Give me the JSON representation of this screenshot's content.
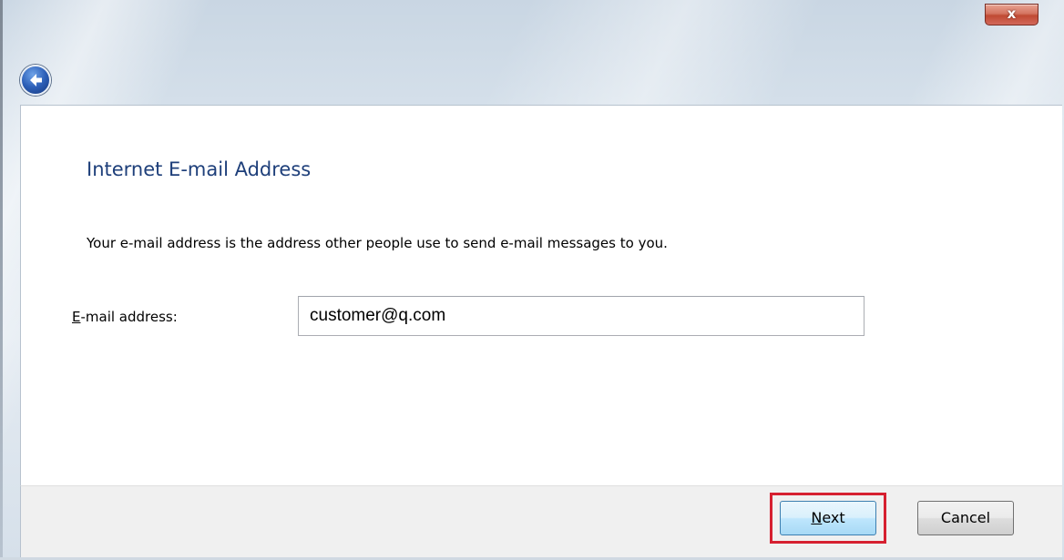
{
  "window": {
    "close_label": "x"
  },
  "page": {
    "heading": "Internet E-mail Address",
    "description": "Your e-mail address is the address other people use to send e-mail messages to you.",
    "email_label_first": "E",
    "email_label_rest": "-mail address:",
    "email_value": "customer@q.com"
  },
  "footer": {
    "next_label": "Next",
    "cancel_label": "Cancel"
  },
  "colors": {
    "heading": "#1e3f7a",
    "highlight": "#d62030",
    "close_button": "#c04a33"
  },
  "icons": {
    "back": "back-arrow-icon",
    "close": "close-icon"
  }
}
